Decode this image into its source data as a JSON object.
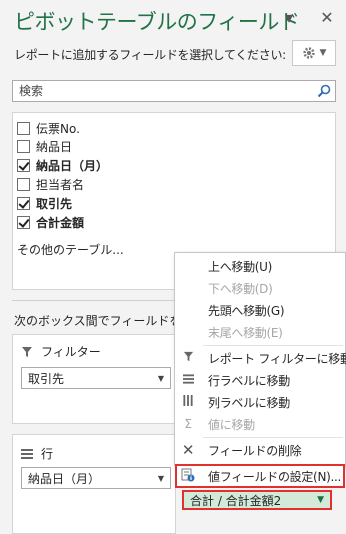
{
  "header": {
    "title": "ピボットテーブルのフィールド",
    "dropdown_glyph": "▾",
    "close_glyph": "✕"
  },
  "subtitle": "レポートに追加するフィールドを選択してください:",
  "search": {
    "placeholder": "検索"
  },
  "fields": [
    {
      "label": "伝票No.",
      "checked": false,
      "bold": false
    },
    {
      "label": "納品日",
      "checked": false,
      "bold": false
    },
    {
      "label": "納品日（月）",
      "checked": true,
      "bold": true
    },
    {
      "label": "担当者名",
      "checked": false,
      "bold": false
    },
    {
      "label": "取引先",
      "checked": true,
      "bold": true
    },
    {
      "label": "合計金額",
      "checked": true,
      "bold": true
    }
  ],
  "more_tables": "その他のテーブル...",
  "areas_hint": "次のボックス間でフィールドをドラッグ",
  "filter_area": {
    "title": "フィルター",
    "item": "取引先"
  },
  "rows_area": {
    "title": "行",
    "item": "納品日（月）"
  },
  "context_menu": {
    "items": [
      {
        "label": "上へ移動(U)",
        "disabled": false,
        "icon": ""
      },
      {
        "label": "下へ移動(D)",
        "disabled": true,
        "icon": ""
      },
      {
        "label": "先頭へ移動(G)",
        "disabled": false,
        "icon": ""
      },
      {
        "label": "末尾へ移動(E)",
        "disabled": true,
        "icon": ""
      },
      {
        "label": "レポート フィルターに移動",
        "disabled": false,
        "icon": "filter-icon"
      },
      {
        "label": "行ラベルに移動",
        "disabled": false,
        "icon": "rows-icon"
      },
      {
        "label": "列ラベルに移動",
        "disabled": false,
        "icon": "columns-icon"
      },
      {
        "label": "値に移動",
        "disabled": true,
        "icon": "sigma-icon"
      },
      {
        "label": "フィールドの削除",
        "disabled": false,
        "icon": "delete-x-icon"
      },
      {
        "label": "値フィールドの設定(N)...",
        "disabled": false,
        "icon": "field-settings-icon",
        "highlighted": true
      }
    ]
  },
  "value_item": "合計 / 合計金額2",
  "colors": {
    "accent": "#217346",
    "highlight": "#e03030",
    "value_bg": "#d3ead8"
  }
}
